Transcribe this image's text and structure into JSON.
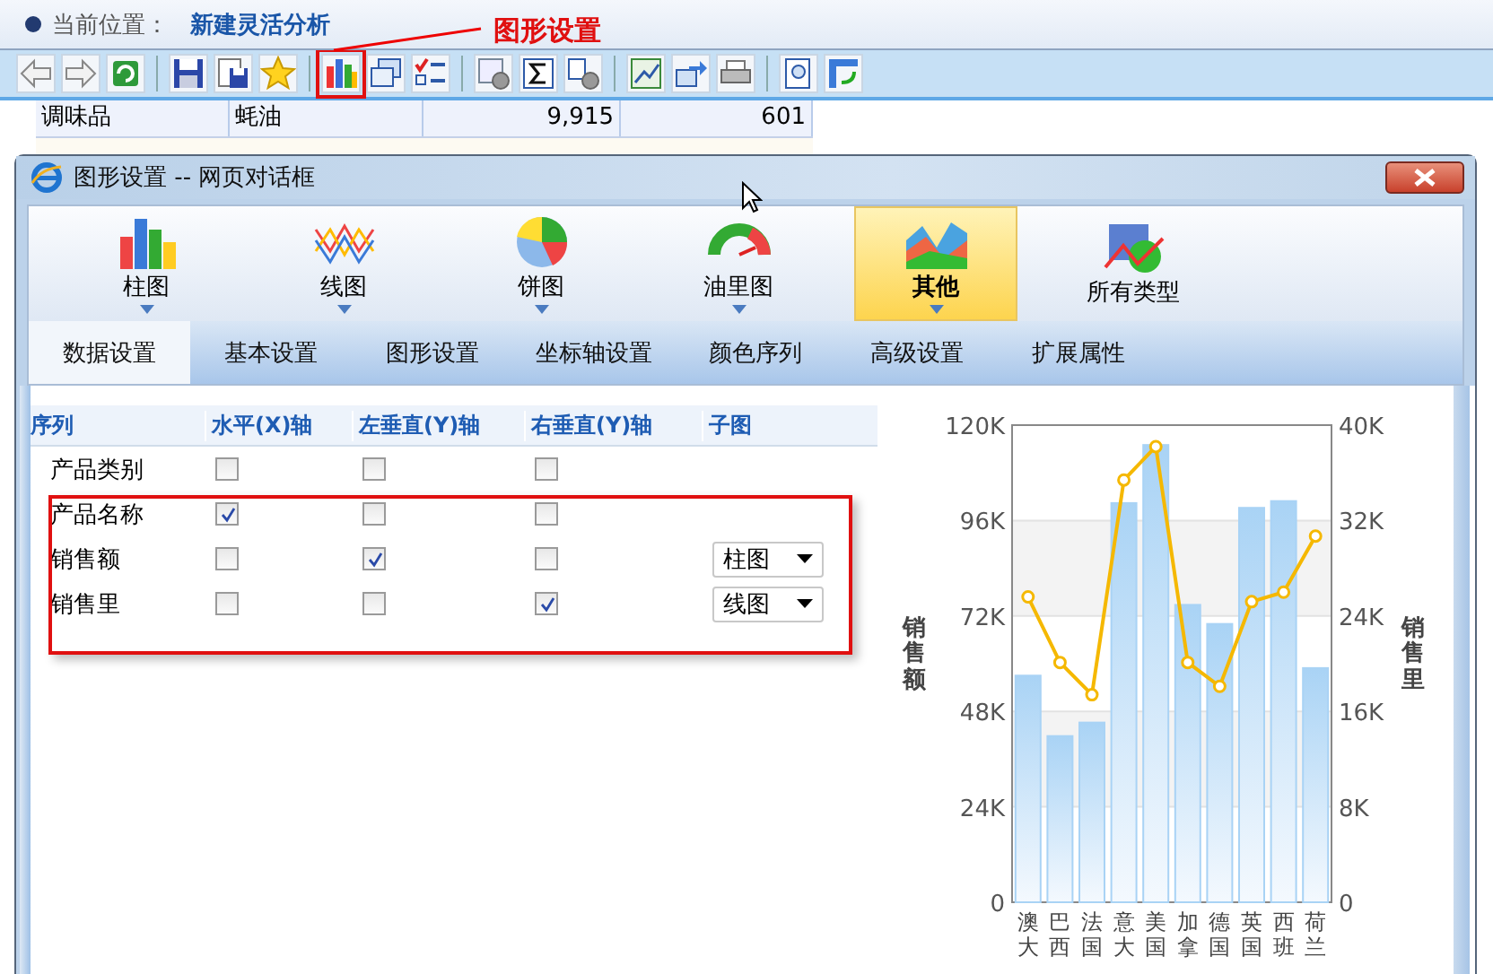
{
  "breadcrumb": {
    "label": "当前位置：",
    "value": "新建灵活分析"
  },
  "annotation": {
    "text": "图形设置"
  },
  "toolbar": {
    "groups": [
      [
        {
          "kind": "back"
        },
        {
          "kind": "forward"
        },
        {
          "kind": "refresh"
        }
      ],
      [
        {
          "kind": "save"
        },
        {
          "kind": "save-as"
        },
        {
          "kind": "star"
        }
      ],
      [
        {
          "kind": "bar-chart",
          "annotated": true
        },
        {
          "kind": "windows"
        },
        {
          "kind": "checklist"
        }
      ],
      [
        {
          "kind": "doc-gear"
        },
        {
          "kind": "sigma"
        },
        {
          "kind": "help-gear"
        }
      ],
      [
        {
          "kind": "excel"
        },
        {
          "kind": "export"
        },
        {
          "kind": "print"
        }
      ],
      [
        {
          "kind": "preview"
        },
        {
          "kind": "swap"
        }
      ]
    ]
  },
  "table": {
    "rows": [
      {
        "cells": [
          "调味品",
          "蚝油",
          "9,915",
          "601"
        ]
      }
    ]
  },
  "dialog": {
    "title": "图形设置 -- 网页对话框",
    "ribbon": [
      {
        "label": "柱图",
        "kind": "bar",
        "dropdown": true,
        "selected": false
      },
      {
        "label": "线图",
        "kind": "line",
        "dropdown": true,
        "selected": false
      },
      {
        "label": "饼图",
        "kind": "pie",
        "dropdown": true,
        "selected": false
      },
      {
        "label": "油里图",
        "kind": "gauge",
        "dropdown": true,
        "selected": false
      },
      {
        "label": "其他",
        "kind": "area",
        "dropdown": true,
        "selected": true
      },
      {
        "label": "所有类型",
        "kind": "mixed",
        "dropdown": false,
        "selected": false
      }
    ],
    "tabs": [
      {
        "label": "数据设置",
        "selected": true
      },
      {
        "label": "基本设置",
        "selected": false
      },
      {
        "label": "图形设置",
        "selected": false
      },
      {
        "label": "坐标轴设置",
        "selected": false
      },
      {
        "label": "颜色序列",
        "selected": false
      },
      {
        "label": "高级设置",
        "selected": false
      },
      {
        "label": "扩展属性",
        "selected": false
      }
    ],
    "grid": {
      "columns": [
        "序列",
        "水平(X)轴",
        "左垂直(Y)轴",
        "右垂直(Y)轴",
        "子图"
      ],
      "rows": [
        {
          "name": "产品类别",
          "x_axis": false,
          "y_left": false,
          "y_right": false,
          "annotated": false
        },
        {
          "name": "产品名称",
          "x_axis": true,
          "y_left": false,
          "y_right": false,
          "annotated": true
        },
        {
          "name": "销售额",
          "x_axis": false,
          "y_left": true,
          "y_right": false,
          "subchart": "柱图",
          "annotated": true
        },
        {
          "name": "销售里",
          "x_axis": false,
          "y_left": false,
          "y_right": true,
          "subchart": "线图",
          "annotated": true
        }
      ]
    },
    "chart": {
      "chart_data": {
        "type": "bar",
        "categories": [
          "澳大",
          "巴西",
          "法国",
          "意大",
          "美国",
          "加拿",
          "德国",
          "英国",
          "西班",
          "荷兰"
        ],
        "series": [
          {
            "color": "#a9d3f5",
            "values": [
              57000,
              41800,
              45200,
              100400,
              115000,
              74800,
              70000,
              99200,
              100900,
              58900
            ]
          },
          {
            "color": "#f5b800",
            "type": "line",
            "axis": "y2",
            "marker": "circle",
            "values": [
              25600,
              20100,
              17400,
              35400,
              38200,
              20100,
              18100,
              25200,
              26000,
              30700
            ]
          }
        ],
        "grid": true,
        "ylabel": "销售额",
        "y2label": "销售里",
        "ylim": [
          0,
          120000
        ],
        "y2lim": [
          0,
          40000
        ],
        "yticks": [
          {
            "value": 0,
            "label": "0"
          },
          {
            "value": 24000,
            "label": "24K"
          },
          {
            "value": 48000,
            "label": "48K"
          },
          {
            "value": 72000,
            "label": "72K"
          },
          {
            "value": 96000,
            "label": "96K"
          },
          {
            "value": 120000,
            "label": "120K"
          }
        ],
        "y2ticks": [
          {
            "value": 0,
            "label": "0"
          },
          {
            "value": 8000,
            "label": "8K"
          },
          {
            "value": 16000,
            "label": "16K"
          },
          {
            "value": 24000,
            "label": "24K"
          },
          {
            "value": 32000,
            "label": "32K"
          },
          {
            "value": 40000,
            "label": "40K"
          }
        ]
      }
    }
  }
}
